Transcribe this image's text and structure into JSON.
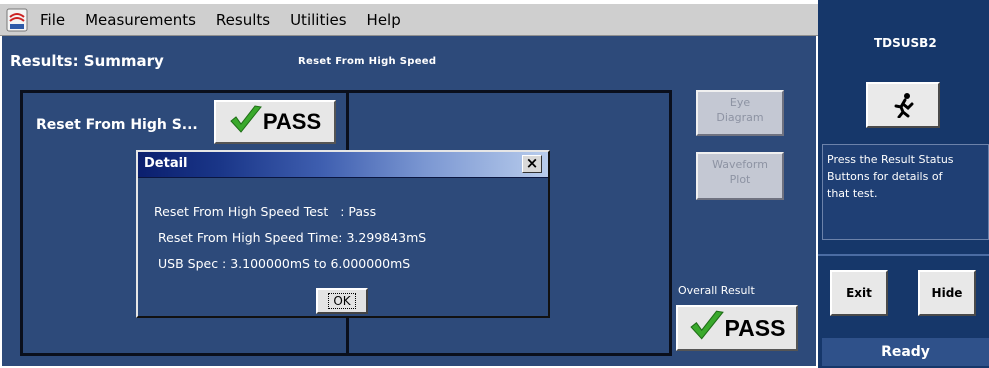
{
  "menu": {
    "items": [
      "File",
      "Measurements",
      "Results",
      "Utilities",
      "Help"
    ]
  },
  "results": {
    "title": "Results: Summary",
    "subtitle": "Reset From High Speed",
    "test_label": "Reset From High S...",
    "test_status": "PASS",
    "eye_diagram_button": [
      "Eye",
      "Diagram"
    ],
    "waveform_plot_button": [
      "Waveform",
      "Plot"
    ],
    "overall_label": "Overall Result",
    "overall_status": "PASS"
  },
  "dialog": {
    "title": "Detail",
    "close_glyph": "×",
    "lines": [
      "Reset From High Speed Test   : Pass",
      "Reset From High Speed Time: 3.299843mS",
      "USB Spec : 3.100000mS to 6.000000mS"
    ],
    "ok_label": "OK"
  },
  "right_panel": {
    "title": "TDSUSB2",
    "run_icon": "running-man-icon",
    "info_lines": [
      "Press the Result Status",
      "Buttons for details of",
      "that test."
    ],
    "exit_label": "Exit",
    "hide_label": "Hide",
    "status": "Ready"
  },
  "colors": {
    "main_background": "#2d4a7a",
    "right_panel_background": "#16376a",
    "pass_check": "#3aa92c",
    "menu_background": "#cfcfcf"
  }
}
